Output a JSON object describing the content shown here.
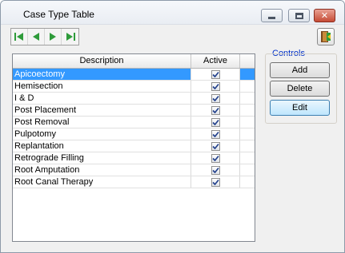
{
  "window": {
    "title": "Case Type Table",
    "close_glyph": "✕"
  },
  "navbar": {
    "buttons": [
      "first-record-icon",
      "previous-record-icon",
      "next-record-icon",
      "last-record-icon"
    ]
  },
  "exit_button": {
    "icon": "exit-door-icon"
  },
  "grid": {
    "columns": [
      "Description",
      "Active"
    ],
    "rows": [
      {
        "description": "Apicoectomy",
        "active": true,
        "selected": true
      },
      {
        "description": "Hemisection",
        "active": true
      },
      {
        "description": "I & D",
        "active": true
      },
      {
        "description": "Post Placement",
        "active": true
      },
      {
        "description": "Post Removal",
        "active": true
      },
      {
        "description": "Pulpotomy",
        "active": true
      },
      {
        "description": "Replantation",
        "active": true
      },
      {
        "description": "Retrograde Filling",
        "active": true
      },
      {
        "description": "Root Amputation",
        "active": true
      },
      {
        "description": "Root Canal Therapy",
        "active": true
      }
    ]
  },
  "controls": {
    "legend": "Controls",
    "add_label": "Add",
    "delete_label": "Delete",
    "edit_label": "Edit"
  },
  "colors": {
    "selection": "#3399ff",
    "legend_text": "#0030c8",
    "nav_green": "#2e9b3a"
  }
}
